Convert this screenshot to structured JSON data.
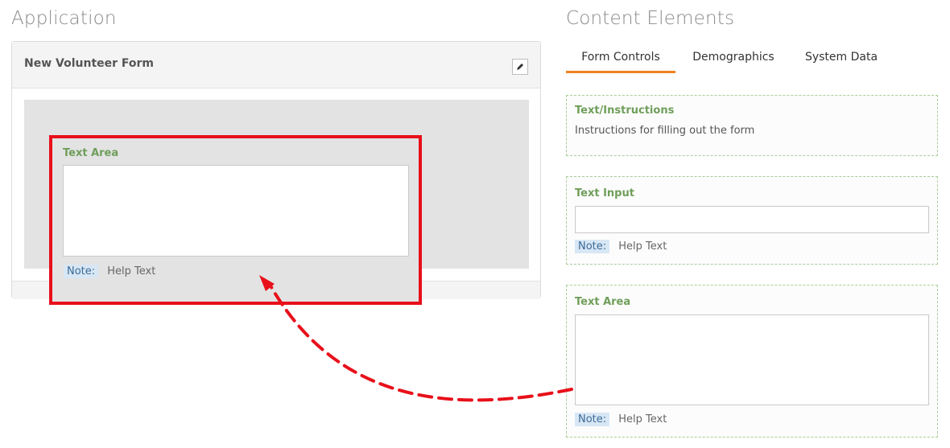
{
  "application": {
    "title": "Application",
    "form_title": "New Volunteer Form",
    "edit_icon": "pencil-icon"
  },
  "dragged_element": {
    "label": "Text Area",
    "note_label": "Note:",
    "help_text": "Help Text"
  },
  "content_elements": {
    "title": "Content Elements",
    "tabs": [
      {
        "label": "Form Controls",
        "active": true
      },
      {
        "label": "Demographics",
        "active": false
      },
      {
        "label": "System Data",
        "active": false
      }
    ],
    "items": [
      {
        "label": "Text/Instructions",
        "text": "Instructions for filling out the form"
      },
      {
        "label": "Text Input",
        "note_label": "Note:",
        "help_text": "Help Text"
      },
      {
        "label": "Text Area",
        "note_label": "Note:",
        "help_text": "Help Text"
      }
    ]
  },
  "colors": {
    "tab_accent": "#f0821e",
    "highlight_red": "#e8101a",
    "label_green": "#6f9e5a",
    "note_blue_bg": "#d8e7f5"
  }
}
